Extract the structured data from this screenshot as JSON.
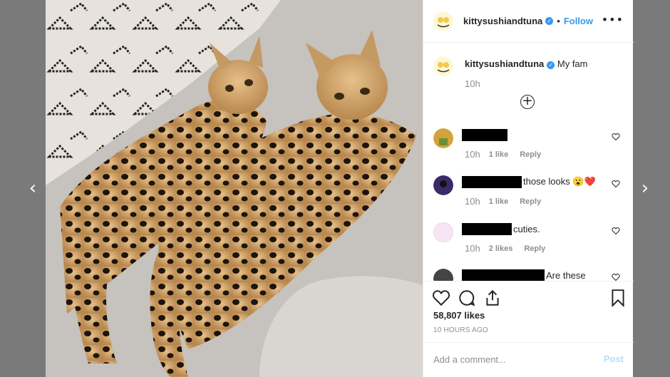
{
  "post": {
    "username": "kittysushiandtuna",
    "follow_label": "Follow",
    "dot": "•",
    "more_label": "•••",
    "caption": "My fam",
    "caption_time": "10h",
    "likes": "58,807 likes",
    "posted": "10 HOURS AGO"
  },
  "comments": [
    {
      "text": "",
      "time": "10h",
      "likes": "1 like",
      "reply": "Reply",
      "avatar_color": "#d4a23a"
    },
    {
      "text": "those looks 😮❤️",
      "time": "10h",
      "likes": "1 like",
      "reply": "Reply",
      "avatar_color": "#3a2a6a"
    },
    {
      "text": "cuties.",
      "time": "10h",
      "likes": "2 likes",
      "reply": "Reply",
      "avatar_color": "#f6e6f4"
    },
    {
      "text": "Are these",
      "time": "",
      "likes": "",
      "reply": "",
      "avatar_color": "#444444"
    }
  ],
  "comment_input": {
    "placeholder": "Add a comment..."
  },
  "post_button": "Post",
  "nav": {
    "prev": "‹",
    "next": "›"
  },
  "colors": {
    "accent": "#3897f0",
    "post_disabled": "#b2dffc",
    "muted": "#8e8e8e"
  },
  "icons": [
    "heart-icon",
    "comment-icon",
    "share-icon",
    "bookmark-icon",
    "plus-circle-icon",
    "verified-badge-icon"
  ]
}
